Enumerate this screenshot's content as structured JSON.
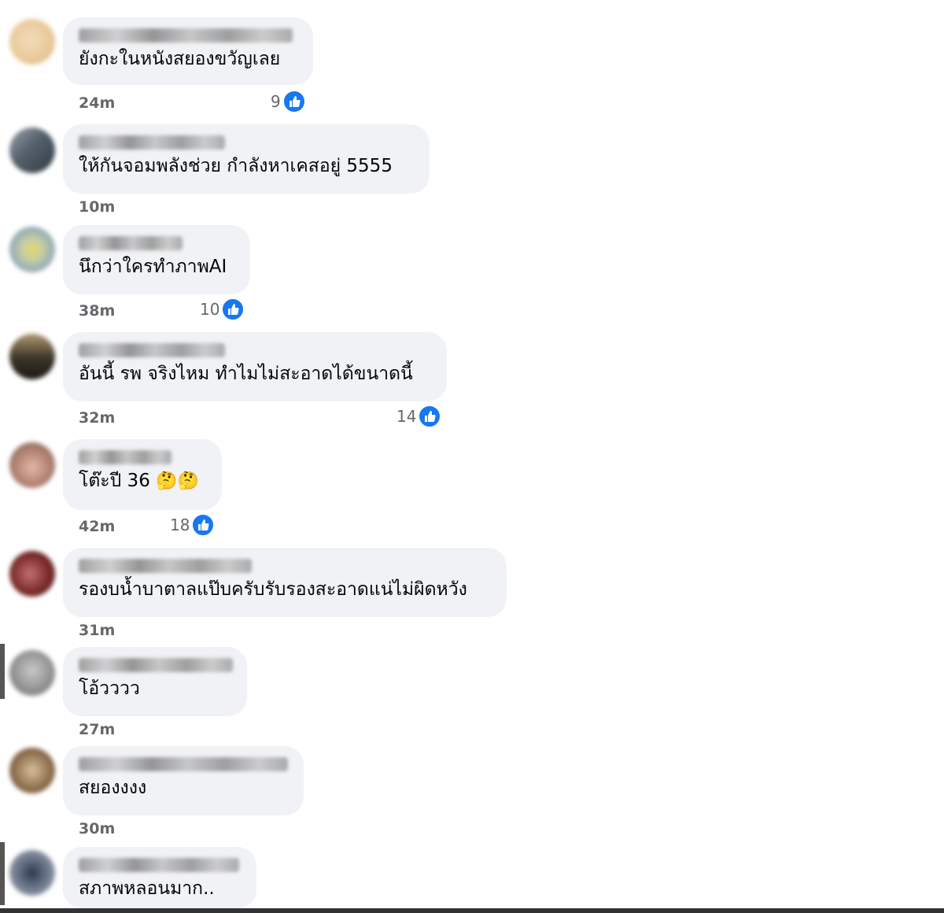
{
  "comments": [
    {
      "text": "ยังกะในหนังสยองขวัญเลย",
      "time": "24m",
      "likes": "9",
      "emoji": "",
      "avatar": [
        "#e8c89a",
        "#f3dcb8"
      ]
    },
    {
      "text": "ให้กันจอมพลังช่วย กำลังหาเคสอยู่ 5555",
      "time": "10m",
      "likes": "",
      "emoji": "",
      "avatar": [
        "#55606b",
        "#9aa3ab"
      ]
    },
    {
      "text": "นึกว่าใครทำภาพAI",
      "time": "38m",
      "likes": "10",
      "emoji": "",
      "avatar": [
        "#8fa9b8",
        "#e6d46a"
      ]
    },
    {
      "text": "อันนี้ รพ จริงไหม ทำไมไม่สะอาดได้ขนาดนี้",
      "time": "32m",
      "likes": "14",
      "emoji": "",
      "avatar": [
        "#3a3226",
        "#b09a70"
      ]
    },
    {
      "text": "โต๊ะปี 36",
      "time": "42m",
      "likes": "18",
      "emoji": "🤔🤔",
      "avatar": [
        "#7a5a50",
        "#e0b8a8"
      ]
    },
    {
      "text": "รองบน้ำบาตาลแป๊บครับรับรองสะอาดแน่ไม่ผิดหวัง",
      "time": "31m",
      "likes": "",
      "emoji": "",
      "avatar": [
        "#7a2b2b",
        "#c47070"
      ]
    },
    {
      "text": "โอ้วววว",
      "time": "27m",
      "likes": "",
      "emoji": "",
      "avatar": [
        "#8f8f8f",
        "#c8c8c8"
      ]
    },
    {
      "text": "สยองงงง",
      "time": "30m",
      "likes": "",
      "emoji": "",
      "avatar": [
        "#8a6a4a",
        "#d8c09a"
      ]
    },
    {
      "text": "สภาพหลอนมาก..",
      "time": "",
      "likes": "",
      "emoji": "",
      "avatar": [
        "#2d3850",
        "#b0b8c8"
      ]
    }
  ]
}
